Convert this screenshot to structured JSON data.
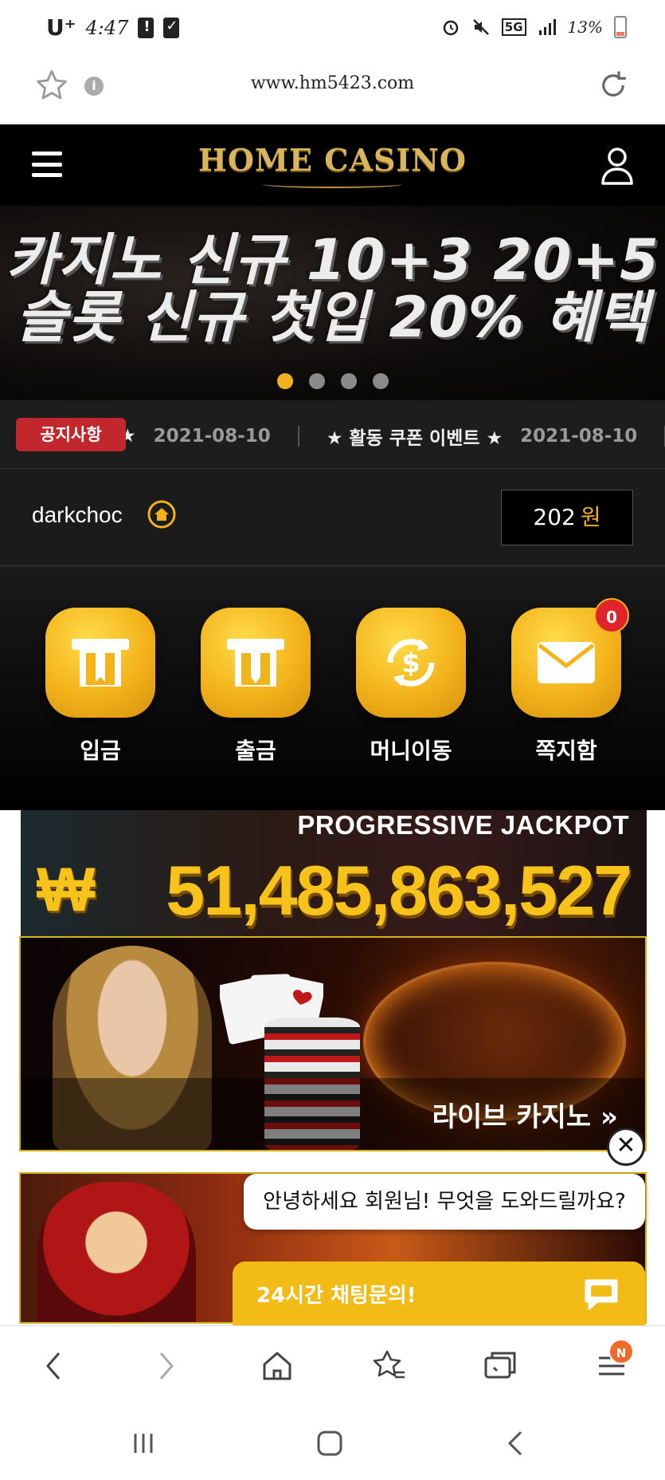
{
  "status_bar": {
    "carrier": "U⁺",
    "time": "4:47",
    "network": "5G",
    "battery": "13%"
  },
  "url_bar": {
    "url": "www.hm5423.com"
  },
  "site_header": {
    "logo_text": "HOME CASINO"
  },
  "banner": {
    "line1": "카지노 신규 10+3  20+5",
    "line2": "슬롯 신규 첫입 20% 혜택",
    "slide_count": 4,
    "active_slide": 1
  },
  "notice": {
    "badge": "공지사항",
    "items": [
      {
        "title": "★",
        "date": "2021-08-10"
      },
      {
        "title": "★ 활동 쿠폰 이벤트 ★",
        "date": "2021-08-10"
      }
    ]
  },
  "user": {
    "username": "darkchoc",
    "balance": "202",
    "currency": "원"
  },
  "quick_menu": {
    "items": [
      {
        "label": "입금"
      },
      {
        "label": "출금"
      },
      {
        "label": "머니이동"
      },
      {
        "label": "쪽지함",
        "count": "0"
      }
    ]
  },
  "jackpot": {
    "title": "PROGRESSIVE JACKPOT",
    "currency": "₩",
    "amount": "51,485,863,527"
  },
  "live_casino": {
    "label": "라이브 카지노 »"
  },
  "chat": {
    "greeting": "안녕하세요 회원님! 무엇을 도와드릴까요?",
    "bar_label": "24시간 채팅문의!",
    "close_glyph": "✕"
  },
  "browser_toolbar": {
    "tabs_badge": "N"
  },
  "colors": {
    "accent_gold": "#f2b21c",
    "notice_red": "#c1272d",
    "chat_yellow": "#f2bb15"
  }
}
